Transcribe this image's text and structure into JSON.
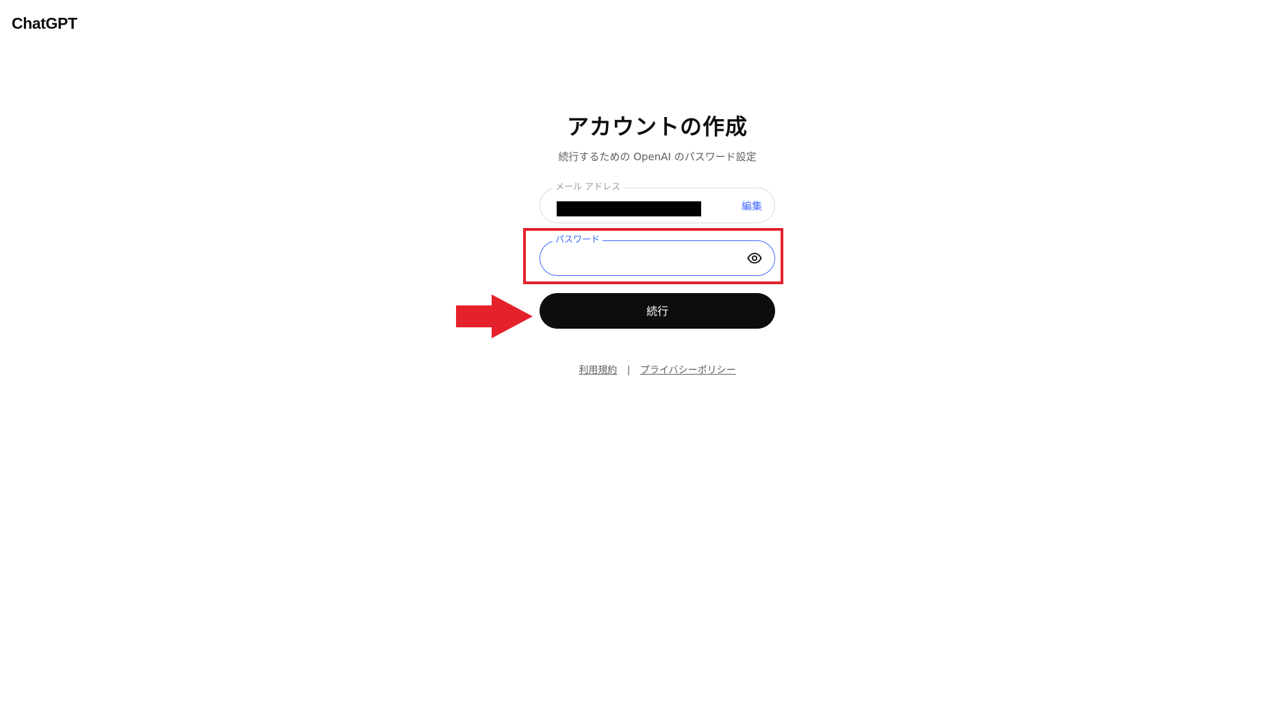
{
  "app": {
    "brand": "ChatGPT"
  },
  "signup": {
    "title": "アカウントの作成",
    "subtitle": "続行するための OpenAI のパスワード設定",
    "email_field": {
      "label": "メール アドレス",
      "value": "[redacted]",
      "edit_label": "編集"
    },
    "password_field": {
      "label": "パスワード",
      "value": "",
      "show_icon": "eye-icon"
    },
    "continue_label": "続行"
  },
  "footer": {
    "terms_label": "利用規約",
    "separator": "|",
    "privacy_label": "プライバシーポリシー"
  },
  "annotations": {
    "highlight_color": "#e5212b",
    "arrow_color": "#e5212b"
  },
  "colors": {
    "accent": "#3e68ff",
    "button_bg": "#0d0d0d",
    "button_text": "#ffffff"
  }
}
